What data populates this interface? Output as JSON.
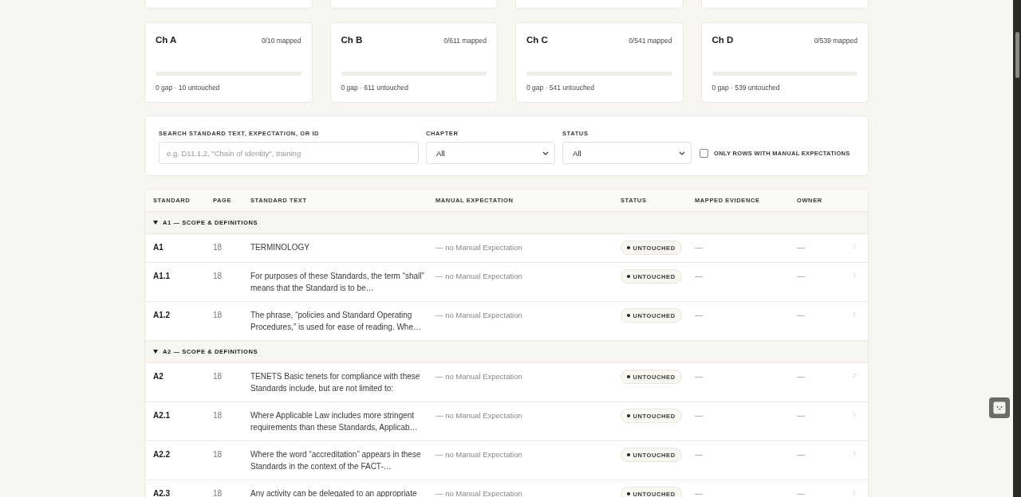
{
  "chapters": [
    {
      "title": "Ch A",
      "mapped": "0/10 mapped",
      "level": 0,
      "summary": "0 gap · 10 untouched"
    },
    {
      "title": "Ch B",
      "mapped": "0/611 mapped",
      "level": 0,
      "summary": "0 gap · 611 untouched"
    },
    {
      "title": "Ch C",
      "mapped": "0/541 mapped",
      "level": 0,
      "summary": "0 gap · 541 untouched"
    },
    {
      "title": "Ch D",
      "mapped": "0/539 mapped",
      "level": 0,
      "summary": "0 gap · 539 untouched"
    }
  ],
  "filters": {
    "search": {
      "label": "SEARCH STANDARD TEXT, EXPECTATION, OR ID",
      "placeholder": "e.g. D11.1.2, \"Chain of Identity\", training"
    },
    "chapter": {
      "label": "CHAPTER",
      "value": "All"
    },
    "status": {
      "label": "STATUS",
      "value": "All"
    },
    "manual_only": {
      "label": "ONLY ROWS WITH MANUAL EXPECTATIONS",
      "checked": false
    }
  },
  "table": {
    "columns": [
      "STANDARD",
      "PAGE",
      "STANDARD TEXT",
      "MANUAL EXPECTATION",
      "STATUS",
      "MAPPED EVIDENCE",
      "OWNER"
    ],
    "groups": [
      {
        "title": "A1 — SCOPE & DEFINITIONS",
        "expanded": true,
        "rows": [
          {
            "standard": "A1",
            "page": "18",
            "text": "TERMINOLOGY",
            "manual": "— no Manual Expectation",
            "status": "UNTOUCHED",
            "evidence": "—",
            "owner": "—"
          },
          {
            "standard": "A1.1",
            "page": "18",
            "text": "For purposes of these Standards, the term “shall” means that the Standard is to be…",
            "manual": "— no Manual Expectation",
            "status": "UNTOUCHED",
            "evidence": "—",
            "owner": "—"
          },
          {
            "standard": "A1.2",
            "page": "18",
            "text": "The phrase, “policies and Standard Operating Procedures,” is used for ease of reading. Whe…",
            "manual": "— no Manual Expectation",
            "status": "UNTOUCHED",
            "evidence": "—",
            "owner": "—"
          }
        ]
      },
      {
        "title": "A2 — SCOPE & DEFINITIONS",
        "expanded": true,
        "rows": [
          {
            "standard": "A2",
            "page": "18",
            "text": "TENETS Basic tenets for compliance with these Standards include, but are not limited to:",
            "manual": "— no Manual Expectation",
            "status": "UNTOUCHED",
            "evidence": "—",
            "owner": "—"
          },
          {
            "standard": "A2.1",
            "page": "18",
            "text": "Where Applicable Law includes more stringent requirements than these Standards, Applicab…",
            "manual": "— no Manual Expectation",
            "status": "UNTOUCHED",
            "evidence": "—",
            "owner": "—"
          },
          {
            "standard": "A2.2",
            "page": "18",
            "text": "Where the word “accreditation” appears in these Standards in the context of the FACT-…",
            "manual": "— no Manual Expectation",
            "status": "UNTOUCHED",
            "evidence": "—",
            "owner": "—"
          },
          {
            "standard": "A2.3",
            "page": "18",
            "text": "Any activity can be delegated to an appropriate",
            "manual": "— no Manual Expectation",
            "status": "UNTOUCHED",
            "evidence": "—",
            "owner": "—"
          }
        ]
      }
    ]
  }
}
